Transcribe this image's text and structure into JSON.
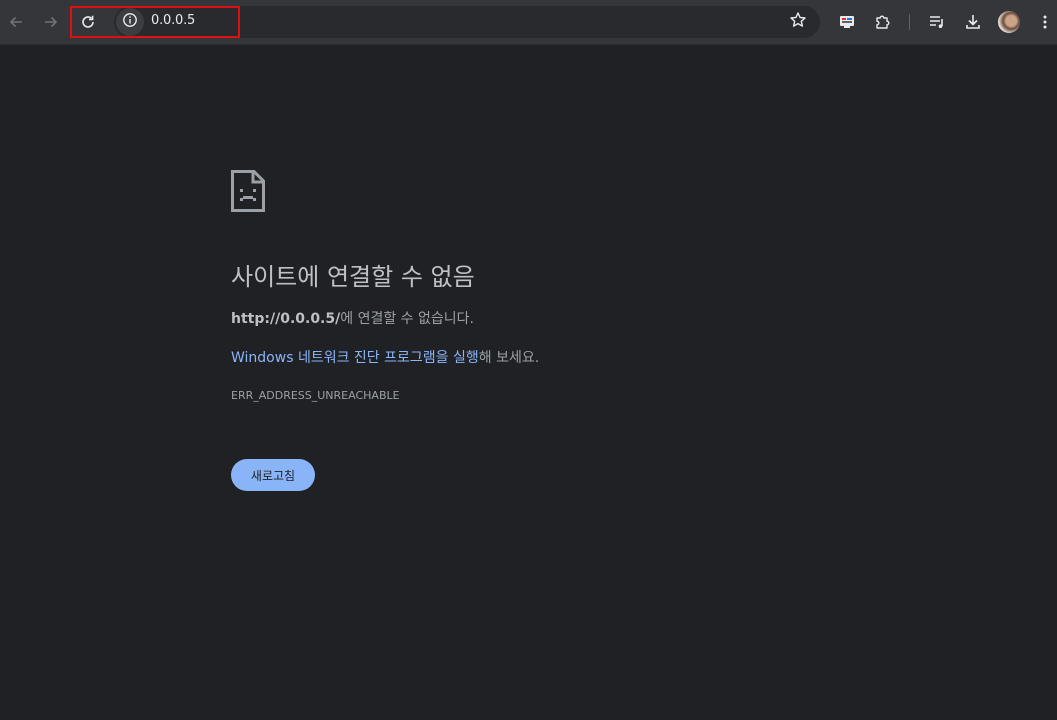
{
  "browser": {
    "url": "0.0.0.5",
    "accent_color": "#8ab4f8",
    "highlight_color": "#e01010",
    "icons": {
      "back": "arrow-left-icon",
      "forward": "arrow-right-icon",
      "reload": "reload-icon",
      "site_info": "info-icon",
      "bookmark": "star-icon",
      "extension_badge": "extension-badge-icon",
      "extensions": "puzzle-icon",
      "media": "media-queue-icon",
      "downloads": "download-icon",
      "profile": "avatar",
      "menu": "more-vert-icon"
    }
  },
  "error_page": {
    "icon": "sad-page-icon",
    "title": "사이트에 연결할 수 없음",
    "message_url": "http://0.0.0.5/",
    "message_rest": "에 연결할 수 없습니다.",
    "diagnostics_link": "Windows 네트워크 진단 프로그램을 실행",
    "diagnostics_rest": "해 보세요.",
    "error_code": "ERR_ADDRESS_UNREACHABLE",
    "reload_button": "새로고침"
  }
}
